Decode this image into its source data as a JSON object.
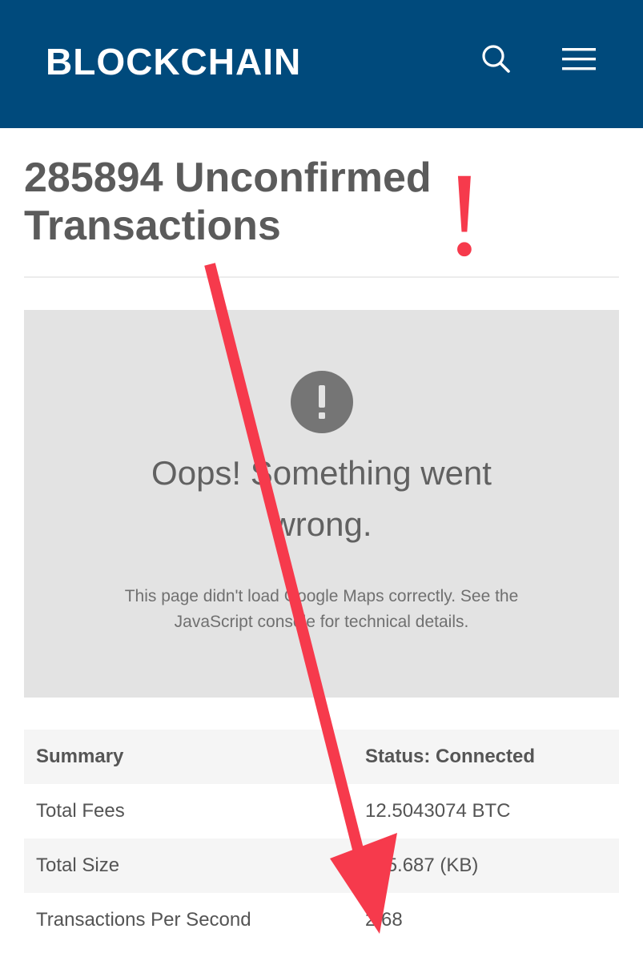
{
  "header": {
    "logo_text": "BLOCKCHAIN",
    "background_color": "#004a7c",
    "search_icon": "search-icon",
    "menu_icon": "hamburger-menu-icon"
  },
  "main": {
    "title_line1": "285894 Unconfirmed",
    "title_line2": "Transactions"
  },
  "map_error": {
    "icon": "exclamation-circle-icon",
    "heading_line1": "Oops! Something went",
    "heading_line2": "wrong.",
    "detail_line1": "This page didn't load Google Maps correctly. See the",
    "detail_line2": "JavaScript console for technical details."
  },
  "summary": {
    "header": {
      "label": "Summary",
      "status": "Status: Connected"
    },
    "rows": [
      {
        "label": "Total Fees",
        "value": "12.5043074 BTC"
      },
      {
        "label": "Total Size",
        "value": "135.687 (KB)"
      },
      {
        "label": "Transactions Per Second",
        "value": "2.68"
      }
    ]
  },
  "annotation": {
    "exclamation_text": "!",
    "color": "#f63a4c"
  }
}
